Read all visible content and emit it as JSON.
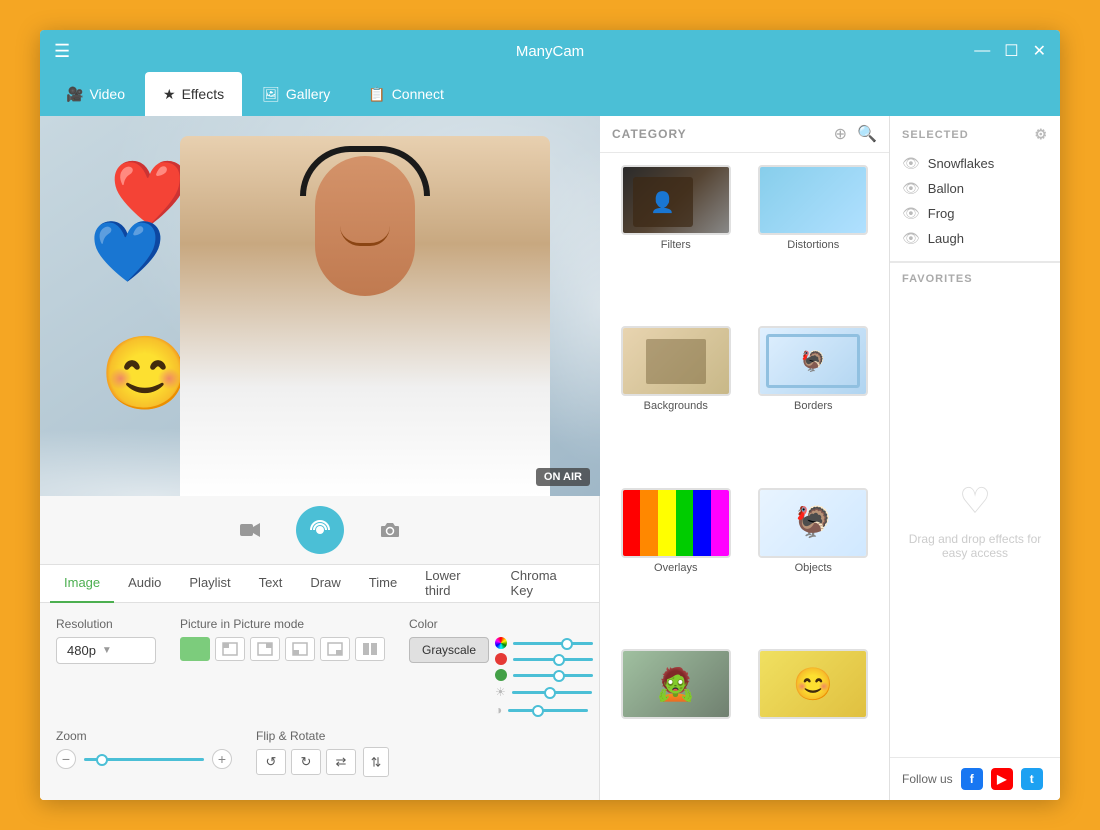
{
  "app": {
    "title": "ManyCam"
  },
  "titlebar": {
    "menu_label": "☰",
    "minimize_label": "—",
    "maximize_label": "☐",
    "close_label": "✕"
  },
  "nav": {
    "tabs": [
      {
        "id": "video",
        "label": "Video",
        "icon": "🎥",
        "active": false
      },
      {
        "id": "effects",
        "label": "Effects",
        "icon": "★",
        "active": true
      },
      {
        "id": "gallery",
        "label": "Gallery",
        "icon": "🖼",
        "active": false
      },
      {
        "id": "connect",
        "label": "Connect",
        "icon": "📋",
        "active": false
      }
    ]
  },
  "video_controls": {
    "camera_icon": "🎥",
    "broadcast_icon": "📡",
    "snapshot_icon": "📷",
    "on_air": "ON AIR"
  },
  "bottom_tabs": {
    "tabs": [
      {
        "id": "image",
        "label": "Image",
        "active": true
      },
      {
        "id": "audio",
        "label": "Audio",
        "active": false
      },
      {
        "id": "playlist",
        "label": "Playlist",
        "active": false
      },
      {
        "id": "text",
        "label": "Text",
        "active": false
      },
      {
        "id": "draw",
        "label": "Draw",
        "active": false
      },
      {
        "id": "time",
        "label": "Time",
        "active": false
      },
      {
        "id": "lower-third",
        "label": "Lower third",
        "active": false
      },
      {
        "id": "chroma-key",
        "label": "Chroma Key",
        "active": false
      }
    ]
  },
  "settings": {
    "resolution_label": "Resolution",
    "resolution_value": "480p",
    "pip_label": "Picture in Picture mode",
    "color_label": "Color",
    "color_btn": "Grayscale",
    "zoom_label": "Zoom",
    "flip_label": "Flip & Rotate"
  },
  "category": {
    "title": "CATEGORY",
    "add_icon": "+",
    "search_icon": "🔍",
    "items": [
      {
        "id": "filters",
        "label": "Filters"
      },
      {
        "id": "distortions",
        "label": "Distortions"
      },
      {
        "id": "backgrounds",
        "label": "Backgrounds"
      },
      {
        "id": "borders",
        "label": "Borders"
      },
      {
        "id": "overlays",
        "label": "Overlays"
      },
      {
        "id": "objects",
        "label": "Objects"
      },
      {
        "id": "faces1",
        "label": ""
      },
      {
        "id": "faces2",
        "label": ""
      }
    ]
  },
  "selected": {
    "title": "SELECTED",
    "filter_icon": "⚙",
    "items": [
      {
        "label": "Snowflakes"
      },
      {
        "label": "Ballon"
      },
      {
        "label": "Frog"
      },
      {
        "label": "Laugh"
      }
    ]
  },
  "favorites": {
    "title": "FAVORITES",
    "empty_text": "Drag and drop effects for easy access",
    "heart_icon": "♡"
  },
  "follow_us": {
    "label": "Follow us",
    "fb": "f",
    "yt": "▶",
    "tw": "t"
  }
}
